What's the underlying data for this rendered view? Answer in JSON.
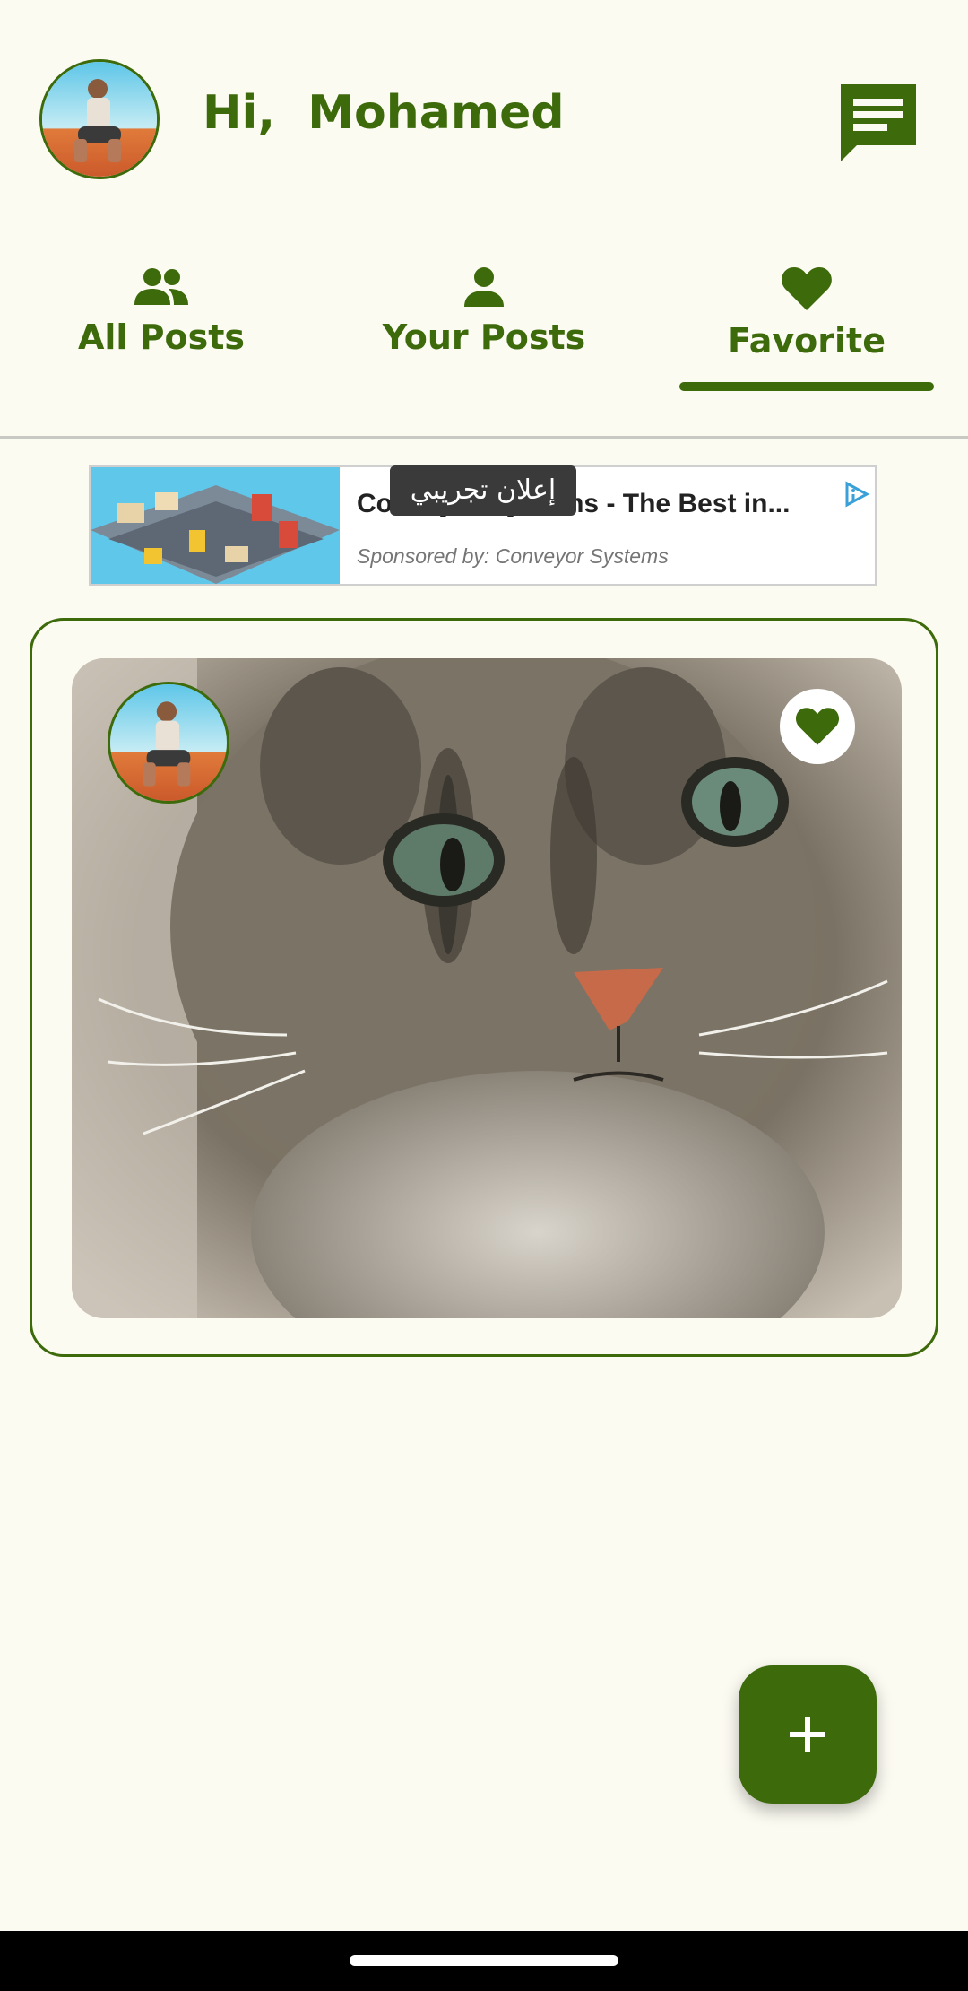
{
  "header": {
    "greeting": "Hi,  Mohamed",
    "avatar_icon": "user-avatar-photo",
    "chat_icon": "chat-message-icon"
  },
  "tabs": [
    {
      "label": "All Posts",
      "icon": "group-icon",
      "selected": false
    },
    {
      "label": "Your Posts",
      "icon": "person-icon",
      "selected": false
    },
    {
      "label": "Favorite",
      "icon": "heart-icon",
      "selected": true
    }
  ],
  "ad": {
    "badge": "إعلان تجريبي",
    "title": "Conveyor Systems - The Best in...",
    "sponsor": "Sponsored by: Conveyor Systems",
    "choices_icon": "adchoices-icon"
  },
  "post": {
    "image": "tabby-cat-photo",
    "favorited": true
  },
  "fab": {
    "icon": "plus-icon"
  },
  "colors": {
    "primary": "#3d6a0b",
    "background": "#fcfbf2"
  }
}
